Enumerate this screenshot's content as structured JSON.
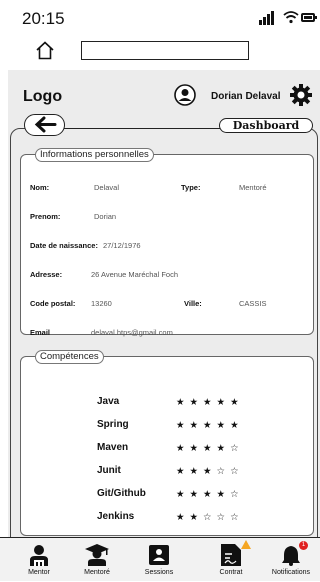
{
  "status": {
    "time": "20:15"
  },
  "header": {
    "logo": "Logo",
    "username": "Dorian Delaval"
  },
  "nav_buttons": {
    "dashboard": "Dashboard"
  },
  "info": {
    "title": "Informations personnelles",
    "nom_label": "Nom:",
    "nom": "Delaval",
    "type_label": "Type:",
    "type": "Mentoré",
    "prenom_label": "Prenom:",
    "prenom": "Dorian",
    "naissance_label": "Date de naissance:",
    "naissance": "27/12/1976",
    "adresse_label": "Adresse:",
    "adresse": "26 Avenue Maréchal Foch",
    "cp_label": "Code postal:",
    "cp": "13260",
    "ville_label": "Ville:",
    "ville": "CASSIS",
    "email_label": "Email",
    "email": "delaval.htps@gmail.com"
  },
  "skills": {
    "title": "Compétences",
    "items": [
      {
        "name": "Java",
        "stars": "★★★★★",
        "rating": 5
      },
      {
        "name": "Spring",
        "stars": "★★★★★",
        "rating": 5
      },
      {
        "name": "Maven",
        "stars": "★★★★☆",
        "rating": 4
      },
      {
        "name": "Junit",
        "stars": "★★★☆☆",
        "rating": 3
      },
      {
        "name": "Git/Github",
        "stars": "★★★★☆",
        "rating": 4
      },
      {
        "name": "Jenkins",
        "stars": "★★☆☆☆",
        "rating": 2
      }
    ]
  },
  "bottom_nav": {
    "mentor": "Mentor",
    "mentore": "Mentoré",
    "sessions": "Sessions",
    "contrat": "Contrat",
    "notifications": "Notifications",
    "notification_count": "1"
  }
}
